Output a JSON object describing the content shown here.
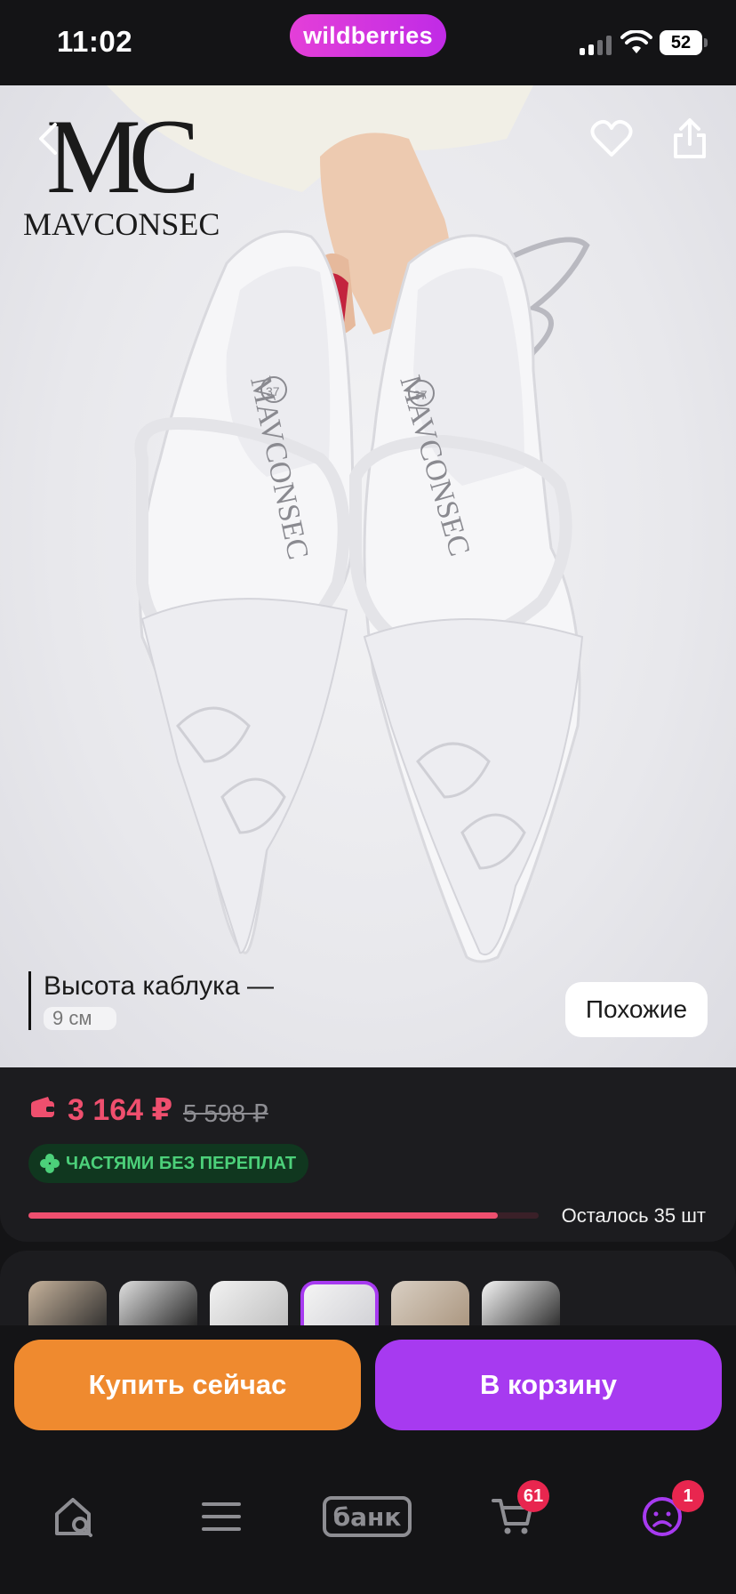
{
  "status_bar": {
    "time": "11:02",
    "battery": "52"
  },
  "brand": {
    "name": "wildberries"
  },
  "product_image": {
    "logo_monogram": "MC",
    "logo_text": "MAVCONSEC",
    "insole_text": "MAVCONSEC",
    "size_mark": "37",
    "caption_line1": "Высота каблука —",
    "caption_line2": "9 см",
    "similar_label": "Похожие"
  },
  "price": {
    "current": "3 164 ₽",
    "old": "5 598 ₽",
    "installment_label": "ЧАСТЯМИ БЕЗ ПЕРЕПЛАТ",
    "stock_label": "Осталось 35 шт",
    "stock_fill_fraction": 0.92
  },
  "thumbnails": {
    "count": 6,
    "active_index": 3
  },
  "actions": {
    "buy_now": "Купить сейчас",
    "add_to_cart": "В корзину"
  },
  "tab_bar": {
    "bank_label": "банк",
    "cart_badge": "61",
    "profile_badge": "1"
  },
  "colors": {
    "price_accent": "#ef4f6e",
    "buy_now": "#ef8a2f",
    "cart_button": "#a73af0",
    "installment_green": "#4cd07a",
    "background": "#141416"
  }
}
